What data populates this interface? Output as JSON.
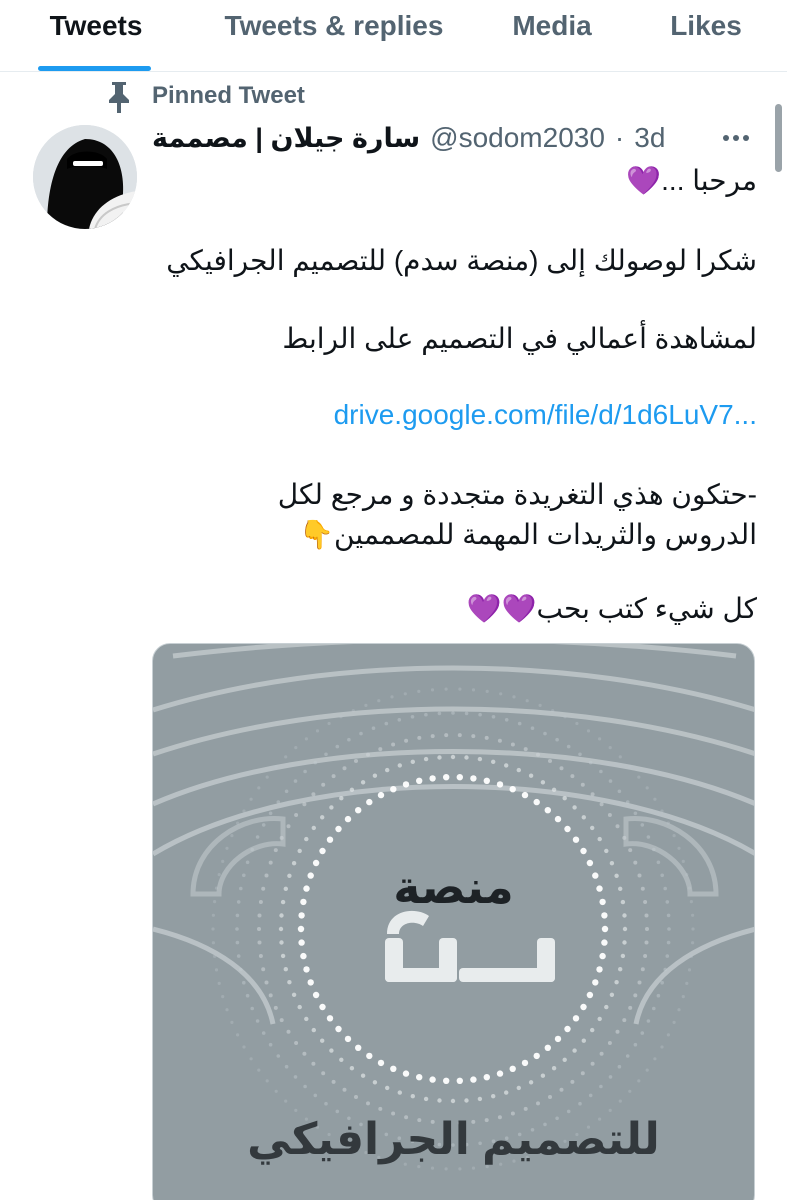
{
  "tabs": [
    {
      "label": "Tweets",
      "active": true
    },
    {
      "label": "Tweets & replies",
      "active": false
    },
    {
      "label": "Media",
      "active": false
    },
    {
      "label": "Likes",
      "active": false
    }
  ],
  "accent_color": "#1d9bf0",
  "pinned": {
    "label": "Pinned Tweet",
    "icon": "pin-icon"
  },
  "tweet": {
    "display_name": "سارة جيلان | مصممة",
    "handle": "@sodom2030",
    "separator": "·",
    "time": "3d",
    "more_icon": "more-horizontal-icon",
    "lines": [
      "مرحبا ...💜",
      "شكرا لوصولك إلى (منصة سدم) للتصميم الجرافيكي",
      "لمشاهدة أعمالي في التصميم على الرابط",
      "-حتكون هذي التغريدة متجددة و مرجع لكل",
      "الدروس والثريدات المهمة للمصممين👇",
      "كل شيء كتب بحب💜💜"
    ],
    "link": "drive.google.com/file/d/1d6LuV7..."
  },
  "media": {
    "title": "منصة",
    "logo_text": "سدم",
    "caption": "للتصميم الجرافيكي",
    "background_color": "#929da2"
  }
}
